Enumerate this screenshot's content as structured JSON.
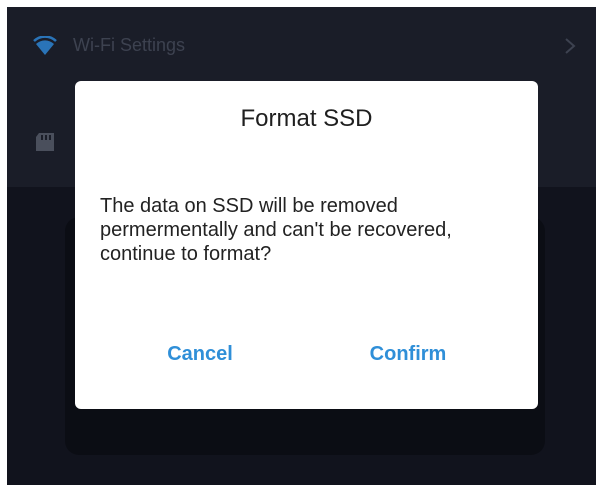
{
  "settings": {
    "wifi_label": "Wi-Fi Settings",
    "wifi_icon": "wifi-icon",
    "ssd_icon": "sd-card-icon",
    "chevron_icon": "chevron-right-icon"
  },
  "dialog": {
    "title": "Format SSD",
    "message": "The data on SSD will be removed permermentally and can't be recovered, continue to format?",
    "cancel_label": "Cancel",
    "confirm_label": "Confirm"
  },
  "colors": {
    "background": "#11131d",
    "panel": "#1a1d28",
    "accent": "#2f8fd8",
    "dialog_bg": "#ffffff"
  }
}
